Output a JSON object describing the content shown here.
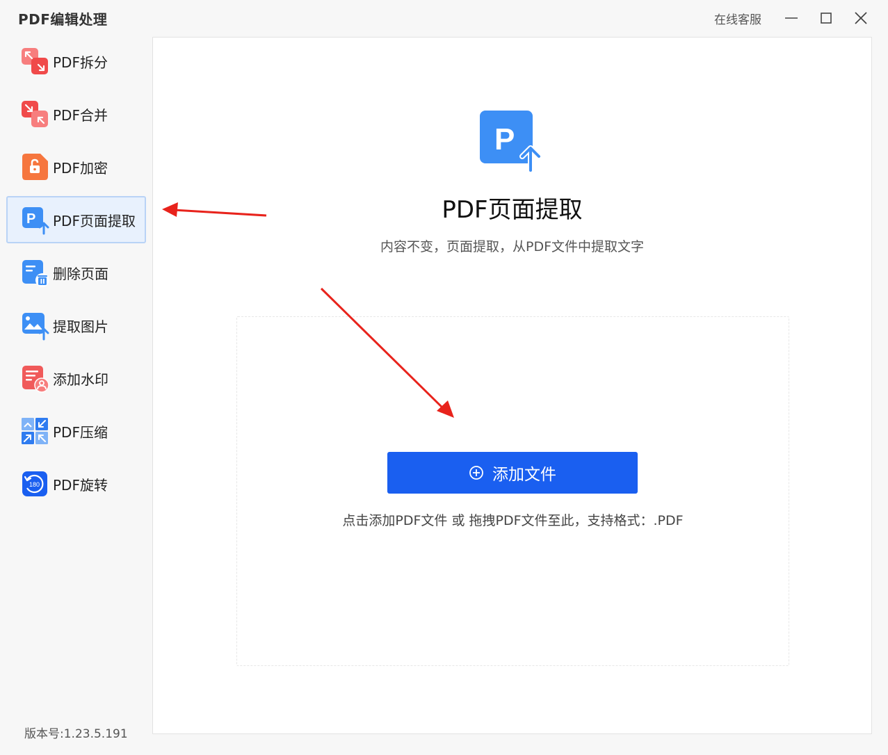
{
  "app": {
    "title": "PDF编辑处理",
    "support_label": "在线客服",
    "version": "版本号:1.23.5.191"
  },
  "window_controls": [
    "minimize-icon",
    "maximize-icon",
    "close-icon"
  ],
  "sidebar": {
    "items": [
      {
        "label": "PDF拆分",
        "icon": "split-icon",
        "active": false
      },
      {
        "label": "PDF合并",
        "icon": "merge-icon",
        "active": false
      },
      {
        "label": "PDF加密",
        "icon": "lock-icon",
        "active": false
      },
      {
        "label": "PDF页面提取",
        "icon": "page-extract-icon",
        "active": true
      },
      {
        "label": "删除页面",
        "icon": "delete-page-icon",
        "active": false
      },
      {
        "label": "提取图片",
        "icon": "extract-image-icon",
        "active": false
      },
      {
        "label": "添加水印",
        "icon": "watermark-icon",
        "active": false
      },
      {
        "label": "PDF压缩",
        "icon": "compress-icon",
        "active": false
      },
      {
        "label": "PDF旋转",
        "icon": "rotate-icon",
        "active": false
      }
    ]
  },
  "main": {
    "icon": "pdf-upload-icon",
    "title": "PDF页面提取",
    "subtitle": "内容不变，页面提取，从PDF文件中提取文字",
    "add_button_label": "添加文件",
    "drop_hint": "点击添加PDF文件 或 拖拽PDF文件至此，支持格式：.PDF"
  },
  "colors": {
    "accent": "#1a5ff0",
    "active_bg": "#e8f1fd",
    "annotation_arrow": "#e8231c",
    "icon_blue": "#3d8ff5",
    "icon_red": "#f05a5a",
    "icon_orange": "#f6763e"
  }
}
